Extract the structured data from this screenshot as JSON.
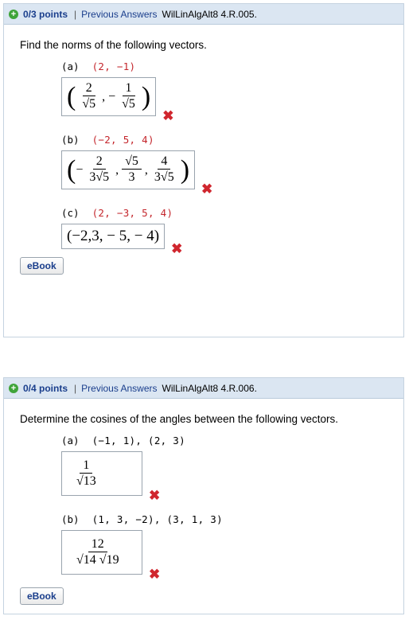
{
  "q1": {
    "points": "0/3 points",
    "sep": "|",
    "previous": "Previous Answers",
    "ref": "WilLinAlgAlt8 4.R.005.",
    "prompt": "Find the norms of the following vectors.",
    "parts": [
      {
        "label": "(a)",
        "vec": "(2, −1)",
        "answer": {
          "frac1_num": "2",
          "frac1_den": "√5",
          "frac2_num": "1",
          "frac2_den": "√5"
        }
      },
      {
        "label": "(b)",
        "vec": "(−2, 5, 4)",
        "answer": {
          "frac1_num": "2",
          "frac1_den": "3√5",
          "frac2_num": "√5",
          "frac2_den": "3",
          "frac3_num": "4",
          "frac3_den": "3√5"
        }
      },
      {
        "label": "(c)",
        "vec": "(2, −3, 5, 4)",
        "answer": {
          "text": "(−2,3, − 5, − 4)"
        }
      }
    ],
    "ebook": "eBook"
  },
  "q2": {
    "points": "0/4 points",
    "sep": "|",
    "previous": "Previous Answers",
    "ref": "WilLinAlgAlt8 4.R.006.",
    "prompt": "Determine the cosines of the angles between the following vectors.",
    "parts": [
      {
        "label": "(a)",
        "vec": "(−1, 1), (2, 3)",
        "answer": {
          "num": "1",
          "den": "√13"
        }
      },
      {
        "label": "(b)",
        "vec": "(1, 3, −2), (3, 1, 3)",
        "answer": {
          "num": "12",
          "den": "√14 √19"
        }
      }
    ],
    "ebook": "eBook"
  },
  "icons": {
    "plus": "plus-circle-icon",
    "wrong": "red-x-icon"
  },
  "colors": {
    "header_bg": "#dbe6f2",
    "link": "#1a3e8c",
    "wrong": "#d0262e",
    "plus": "#3fa43a"
  }
}
